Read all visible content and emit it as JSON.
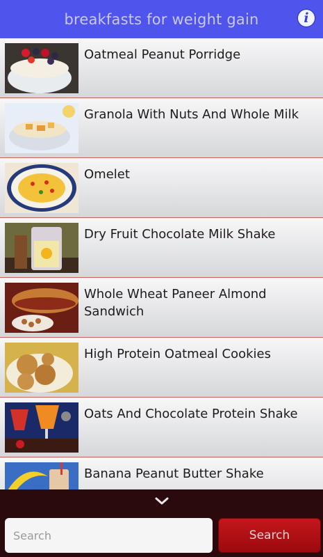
{
  "header": {
    "title": "breakfasts for weight gain",
    "info_icon": "info-icon"
  },
  "items": [
    {
      "title": "Oatmeal Peanut Porridge"
    },
    {
      "title": "Granola With Nuts And Whole Milk"
    },
    {
      "title": "Omelet"
    },
    {
      "title": "Dry Fruit Chocolate Milk Shake"
    },
    {
      "title": "Whole Wheat Paneer Almond Sandwich"
    },
    {
      "title": "High Protein Oatmeal Cookies"
    },
    {
      "title": "Oats And Chocolate Protein Shake"
    },
    {
      "title": "Banana Peanut Butter Shake"
    }
  ],
  "footer": {
    "search_placeholder": "Search",
    "search_button": "Search"
  },
  "colors": {
    "header": "#4f54ec",
    "footer": "#2a0a0c",
    "button": "#c5161b"
  }
}
